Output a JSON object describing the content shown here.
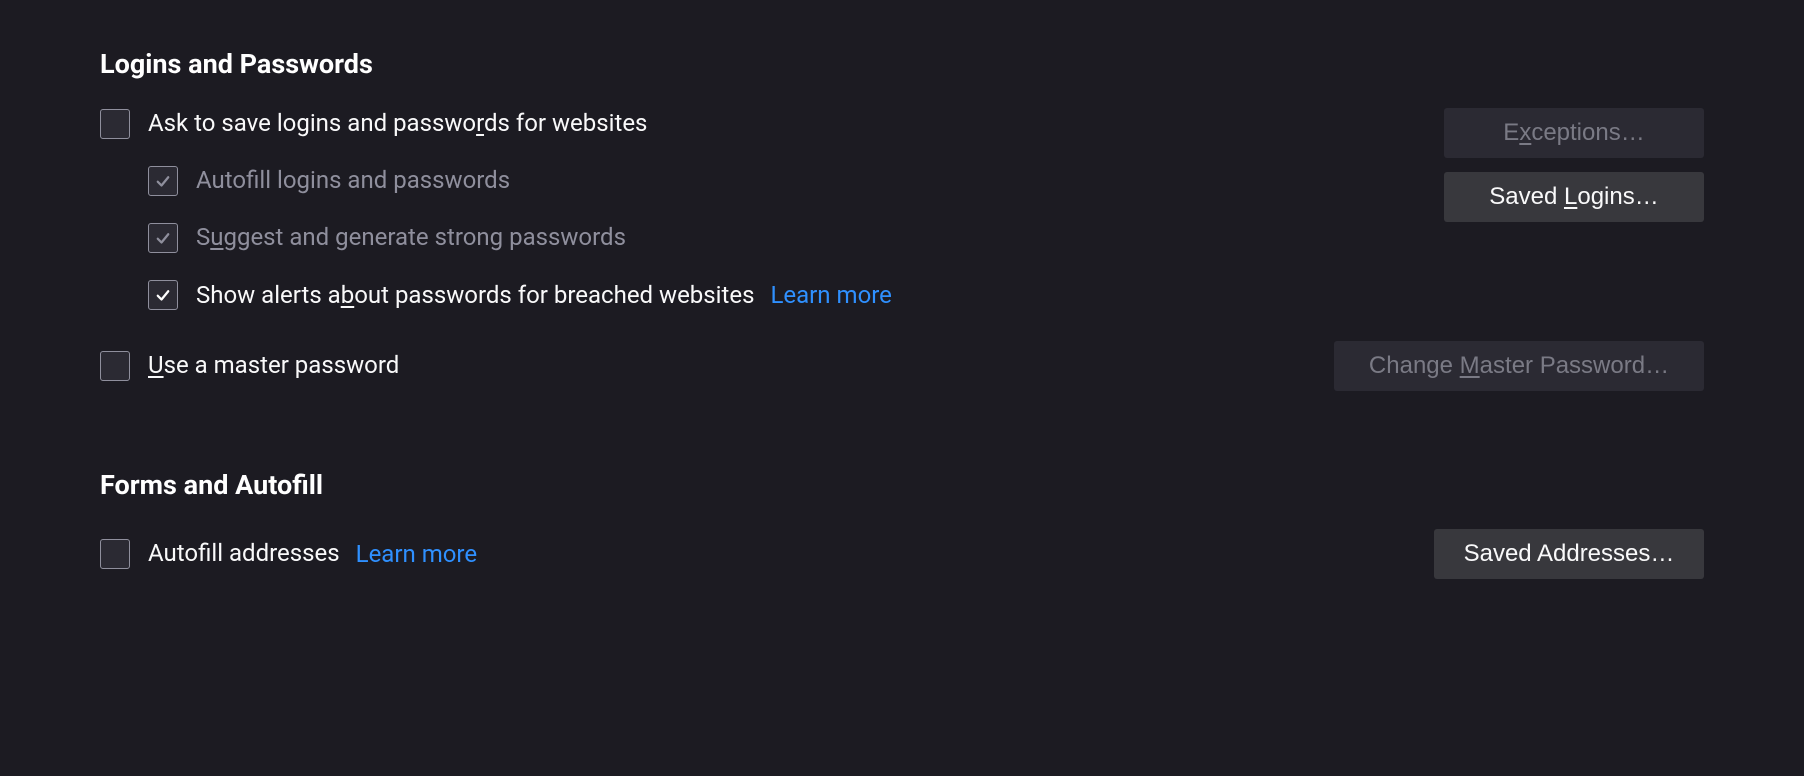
{
  "logins": {
    "heading": "Logins and Passwords",
    "ask_to_save": {
      "before": "Ask to save logins and passwo",
      "ul": "r",
      "after": "ds for websites",
      "checked": false,
      "disabled": false
    },
    "autofill": {
      "before": "Autof",
      "ul": "i",
      "after": "ll logins and passwords",
      "checked": true,
      "disabled": true
    },
    "suggest": {
      "before": "S",
      "ul": "u",
      "after": "ggest and generate strong passwords",
      "checked": true,
      "disabled": true
    },
    "breached": {
      "before": "Show alerts a",
      "ul": "b",
      "after": "out passwords for breached websites",
      "checked": true,
      "disabled": false,
      "learn_more": "Learn more"
    },
    "master": {
      "before": "",
      "ul": "U",
      "after": "se a master password",
      "checked": false,
      "disabled": false
    },
    "btn_exceptions": {
      "before": "E",
      "ul": "x",
      "after": "ceptions…",
      "disabled": true
    },
    "btn_saved_logins": {
      "before": "Saved ",
      "ul": "L",
      "after": "ogins…",
      "disabled": false
    },
    "btn_change_master": {
      "before": "Change ",
      "ul": "M",
      "after": "aster Password…",
      "disabled": true
    }
  },
  "forms": {
    "heading": "Forms and Autofill",
    "autofill_addresses": {
      "label": "Autofill addresses",
      "checked": false,
      "disabled": false,
      "learn_more": "Learn more"
    },
    "btn_saved_addresses": {
      "label": "Saved Addresses…",
      "disabled": false
    }
  }
}
